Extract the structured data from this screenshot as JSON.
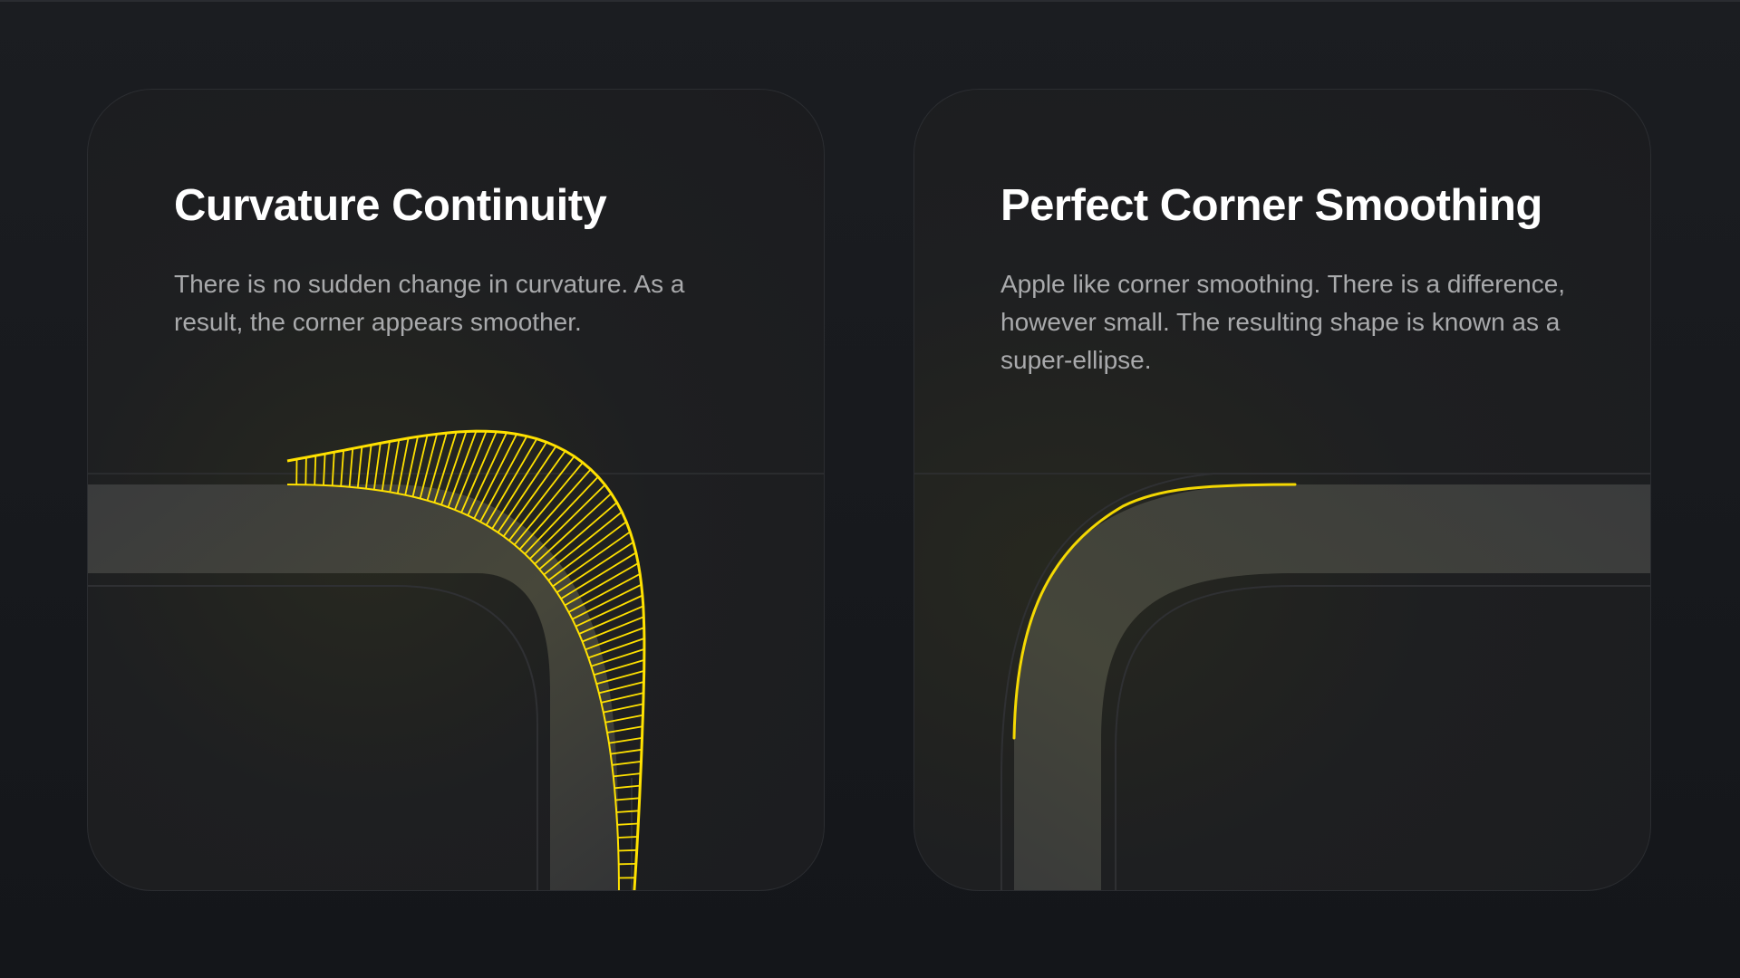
{
  "cards": [
    {
      "title": "Curvature Continuity",
      "description": "There is no sudden change in curvature. As a result, the corner appears smoother."
    },
    {
      "title": "Perfect Corner Smoothing",
      "description": "Apple like corner smoothing. There is a difference, however small. The resulting shape is known as a super-ellipse."
    }
  ],
  "colors": {
    "background": "#16181c",
    "card": "#1e1f21",
    "accent": "#ffe100",
    "band": "#38393b",
    "title": "#ffffff",
    "text": "#a9aaac"
  }
}
